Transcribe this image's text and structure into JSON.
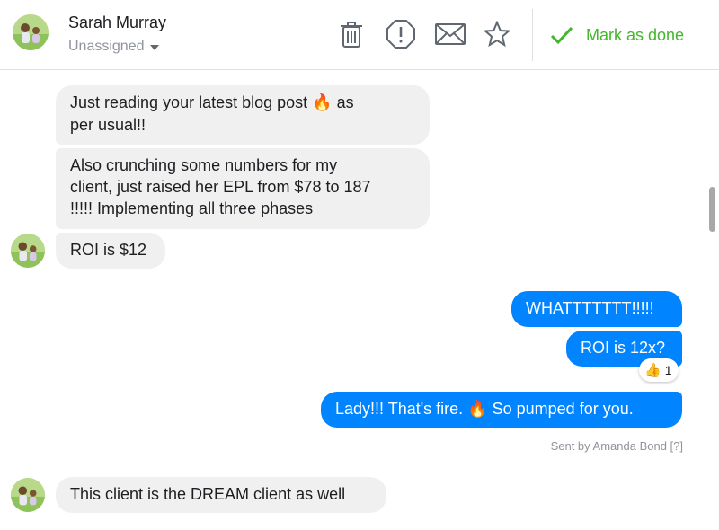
{
  "header": {
    "contact_name": "Sarah Murray",
    "assignment": "Unassigned",
    "actions": [
      {
        "icon": "trash-icon"
      },
      {
        "icon": "alert-icon"
      },
      {
        "icon": "envelope-icon"
      },
      {
        "icon": "star-icon"
      }
    ],
    "mark_done_label": "Mark as done",
    "accent_color": "#42b72a"
  },
  "messages": {
    "m1_text": "Just reading your latest blog post",
    "m1_emoji": "🔥",
    "m1_tail": "as",
    "m1_line2": "per usual!!",
    "m2_line1": "Also crunching some numbers for my",
    "m2_line2": "client, just raised her EPL from $78 to 187",
    "m2_line3": "!!!!! Implementing all three phases",
    "m3_text": "ROI is $12",
    "m4_text": "WHATTTTTTT!!!!!",
    "m5_text": "ROI is 12x?",
    "m5_reaction_emoji": "👍",
    "m5_reaction_count": "1",
    "m6_text_a": "Lady!!! That's fire.",
    "m6_emoji": "🔥",
    "m6_text_b": "So pumped for you.",
    "sent_by": "Sent by Amanda Bond [?]",
    "m7_text": "This client is the DREAM client as well"
  },
  "colors": {
    "incoming_bubble": "#f1f0f0",
    "outgoing_bubble": "#0084ff"
  }
}
